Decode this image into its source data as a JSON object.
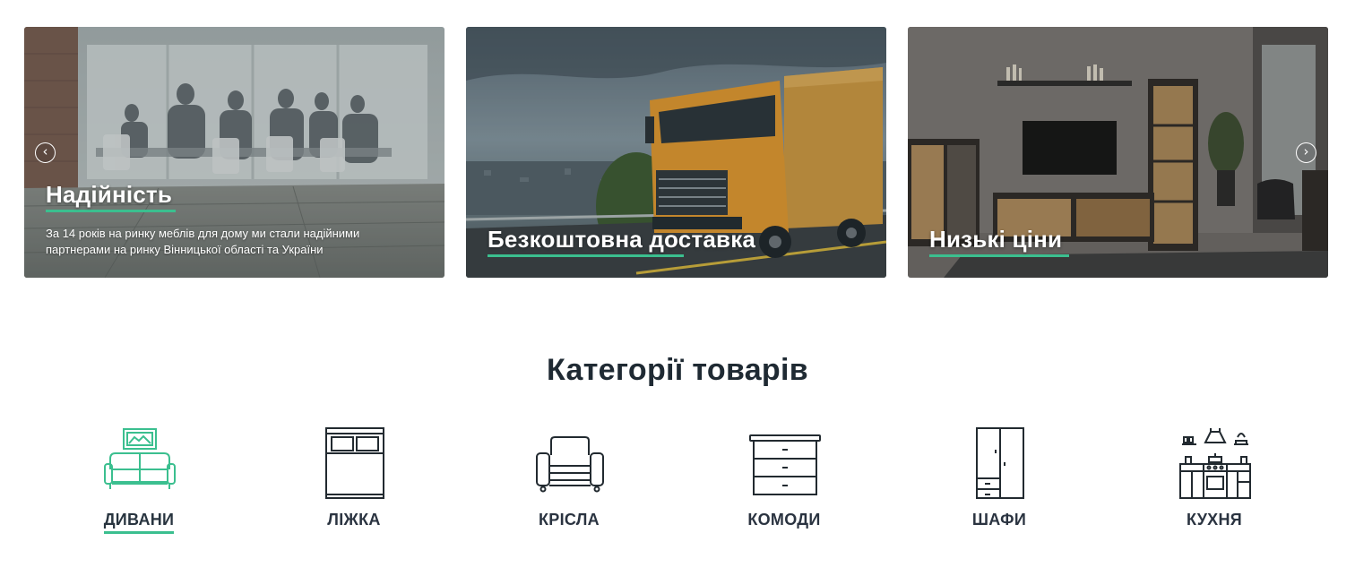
{
  "colors": {
    "accent": "#3bbf8f",
    "text": "#1f2a33"
  },
  "slider": {
    "prev_icon": "chevron-left-icon",
    "next_icon": "chevron-right-icon",
    "slides": [
      {
        "title": "Надійність",
        "text": "За 14 років на ринку меблів для дому ми стали надійними партнерами на ринку Вінницької області та України",
        "image": "office-meeting-photo"
      },
      {
        "title": "Безкоштовна доставка",
        "image": "delivery-truck-photo"
      },
      {
        "title": "Низькі ціни",
        "image": "living-room-furniture-photo"
      }
    ]
  },
  "categories": {
    "title": "Категорії товарів",
    "items": [
      {
        "label": "ДИВАНИ",
        "icon": "sofa-icon",
        "active": true
      },
      {
        "label": "ЛІЖКА",
        "icon": "bed-icon"
      },
      {
        "label": "КРІСЛА",
        "icon": "armchair-icon"
      },
      {
        "label": "КОМОДИ",
        "icon": "dresser-icon"
      },
      {
        "label": "ШАФИ",
        "icon": "wardrobe-icon"
      },
      {
        "label": "КУХНЯ",
        "icon": "kitchen-icon"
      }
    ]
  }
}
